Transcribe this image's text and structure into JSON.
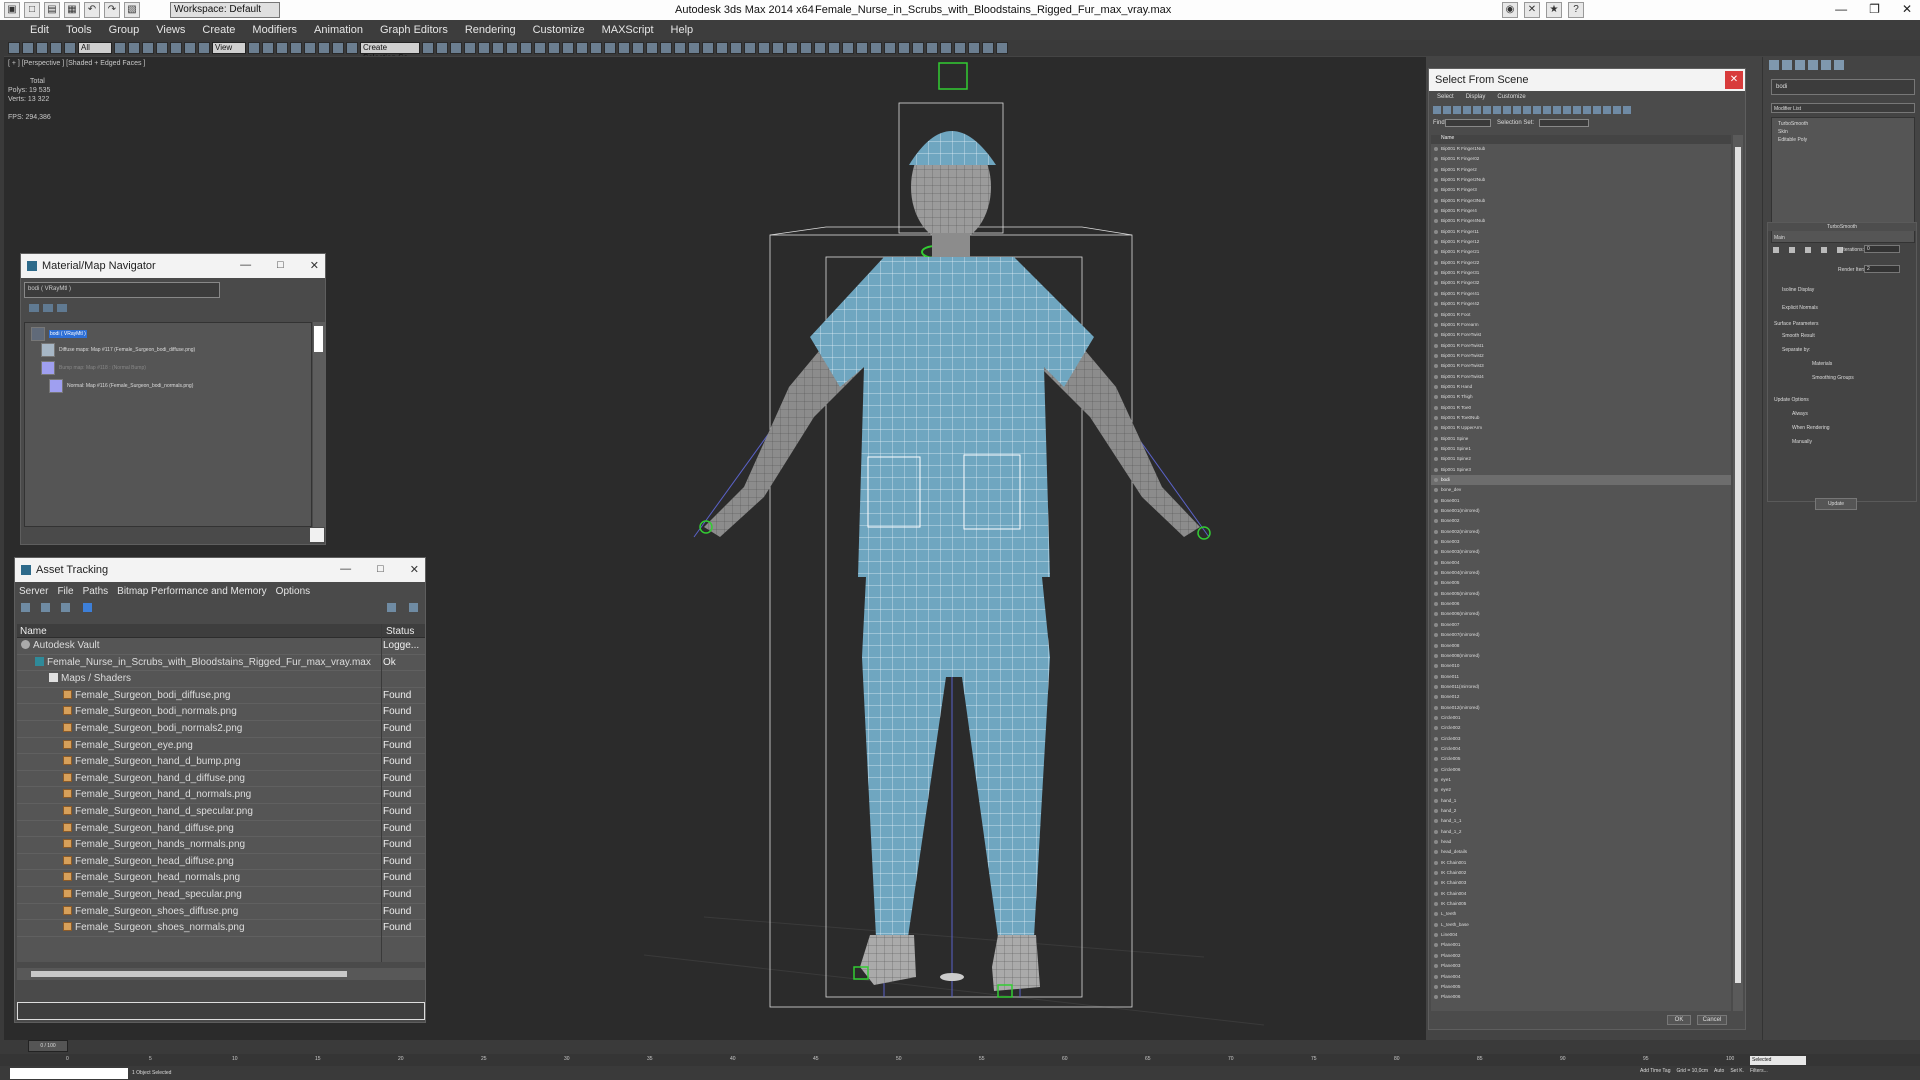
{
  "titlebar": {
    "workspace": "Workspace: Default",
    "app_title": "Autodesk 3ds Max  2014 x64",
    "file_title": "Female_Nurse_in_Scrubs_with_Bloodstains_Rigged_Fur_max_vray.max"
  },
  "menubar": [
    "Edit",
    "Tools",
    "Group",
    "Views",
    "Create",
    "Modifiers",
    "Animation",
    "Graph Editors",
    "Rendering",
    "Customize",
    "MAXScript",
    "Help"
  ],
  "toolbar": {
    "selection_filter": "All",
    "reference_coord": "View",
    "selection_set": "Create Selection Se"
  },
  "viewport": {
    "label": "[ + ] [Perspective ] [Shaded + Edged Faces ]",
    "stats": {
      "total_label": "Total",
      "polys_label": "Polys:",
      "polys_value": "19 535",
      "verts_label": "Verts:",
      "verts_value": "13 322",
      "fps_label": "FPS:",
      "fps_value": "294,386"
    }
  },
  "material_navigator": {
    "title": "Material/Map Navigator",
    "field": "bodi ( VRayMtl )",
    "tree": {
      "root": "bodi ( VRayMtl )",
      "diffuse": "Diffuse maps: Map #117 (Female_Surgeon_bodi_diffuse.png)",
      "bump": "Bump map: Map #118 : (Normal Bump)",
      "normal": "Normal: Map #116 (Female_Surgeon_bodi_normals.png)"
    }
  },
  "asset_tracking": {
    "title": "Asset Tracking",
    "menu": [
      "Server",
      "File",
      "Paths",
      "Bitmap Performance and Memory",
      "Options"
    ],
    "columns": {
      "name": "Name",
      "status": "Status"
    },
    "rows": [
      {
        "name": "Autodesk Vault",
        "status": "Logge...",
        "indent": 0,
        "icon": "vault"
      },
      {
        "name": "Female_Nurse_in_Scrubs_with_Bloodstains_Rigged_Fur_max_vray.max",
        "status": "Ok",
        "indent": 1,
        "icon": "max"
      },
      {
        "name": "Maps / Shaders",
        "status": "",
        "indent": 2,
        "icon": "folder"
      },
      {
        "name": "Female_Surgeon_bodi_diffuse.png",
        "status": "Found",
        "indent": 3,
        "icon": "file"
      },
      {
        "name": "Female_Surgeon_bodi_normals.png",
        "status": "Found",
        "indent": 3,
        "icon": "file"
      },
      {
        "name": "Female_Surgeon_bodi_normals2.png",
        "status": "Found",
        "indent": 3,
        "icon": "file"
      },
      {
        "name": "Female_Surgeon_eye.png",
        "status": "Found",
        "indent": 3,
        "icon": "file"
      },
      {
        "name": "Female_Surgeon_hand_d_bump.png",
        "status": "Found",
        "indent": 3,
        "icon": "file"
      },
      {
        "name": "Female_Surgeon_hand_d_diffuse.png",
        "status": "Found",
        "indent": 3,
        "icon": "file"
      },
      {
        "name": "Female_Surgeon_hand_d_normals.png",
        "status": "Found",
        "indent": 3,
        "icon": "file"
      },
      {
        "name": "Female_Surgeon_hand_d_specular.png",
        "status": "Found",
        "indent": 3,
        "icon": "file"
      },
      {
        "name": "Female_Surgeon_hand_diffuse.png",
        "status": "Found",
        "indent": 3,
        "icon": "file"
      },
      {
        "name": "Female_Surgeon_hands_normals.png",
        "status": "Found",
        "indent": 3,
        "icon": "file"
      },
      {
        "name": "Female_Surgeon_head_diffuse.png",
        "status": "Found",
        "indent": 3,
        "icon": "file"
      },
      {
        "name": "Female_Surgeon_head_normals.png",
        "status": "Found",
        "indent": 3,
        "icon": "file"
      },
      {
        "name": "Female_Surgeon_head_specular.png",
        "status": "Found",
        "indent": 3,
        "icon": "file"
      },
      {
        "name": "Female_Surgeon_shoes_diffuse.png",
        "status": "Found",
        "indent": 3,
        "icon": "file"
      },
      {
        "name": "Female_Surgeon_shoes_normals.png",
        "status": "Found",
        "indent": 3,
        "icon": "file"
      }
    ]
  },
  "select_from_scene": {
    "title": "Select From Scene",
    "menu": [
      "Select",
      "Display",
      "Customize"
    ],
    "find_label": "Find:",
    "selection_set_label": "Selection Set:",
    "column_name": "Name",
    "selected_item": "bodi",
    "items": [
      "Bip001 R Finger1Nub",
      "Bip001 R Finger02",
      "Bip001 R Finger2",
      "Bip001 R Finger2Nub",
      "Bip001 R Finger3",
      "Bip001 R Finger3Nub",
      "Bip001 R Finger4",
      "Bip001 R Finger4Nub",
      "Bip001 R Finger11",
      "Bip001 R Finger12",
      "Bip001 R Finger21",
      "Bip001 R Finger22",
      "Bip001 R Finger31",
      "Bip001 R Finger32",
      "Bip001 R Finger41",
      "Bip001 R Finger42",
      "Bip001 R Foot",
      "Bip001 R Forearm",
      "Bip001 R ForeTwist",
      "Bip001 R ForeTwist1",
      "Bip001 R ForeTwist2",
      "Bip001 R ForeTwist3",
      "Bip001 R ForeTwist4",
      "Bip001 R Hand",
      "Bip001 R Thigh",
      "Bip001 R Toe0",
      "Bip001 R Toe0Nub",
      "Bip001 R UpperArm",
      "Bip001 Spine",
      "Bip001 Spine1",
      "Bip001 Spine2",
      "Bip001 Spine3",
      "bodi",
      "bone_dev",
      "Bone001",
      "Bone001(mirrored)",
      "Bone002",
      "Bone002(mirrored)",
      "Bone003",
      "Bone003(mirrored)",
      "Bone004",
      "Bone004(mirrored)",
      "Bone005",
      "Bone005(mirrored)",
      "Bone006",
      "Bone006(mirrored)",
      "Bone007",
      "Bone007(mirrored)",
      "Bone008",
      "Bone008(mirrored)",
      "Bone010",
      "Bone011",
      "Bone011(mirrored)",
      "Bone012",
      "Bone012(mirrored)",
      "Circle001",
      "Circle002",
      "Circle003",
      "Circle004",
      "Circle005",
      "Circle006",
      "eye1",
      "eye2",
      "hand_1",
      "hand_2",
      "hand_1_1",
      "hand_1_2",
      "head",
      "head_details",
      "IK Chain001",
      "IK Chain002",
      "IK Chain003",
      "IK Chain004",
      "IK Chain005",
      "L_teeth",
      "L_teeth_base",
      "Line004",
      "Plane001",
      "Plane002",
      "Plane003",
      "Plane004",
      "Plane005",
      "Plane006"
    ],
    "ok_label": "OK",
    "cancel_label": "Cancel"
  },
  "command_panel": {
    "object_name": "bodi",
    "modifier_list_label": "Modifier List",
    "stack": [
      "TurboSmooth",
      "Skin",
      "Editable Poly"
    ],
    "turbosmooth_title": "TurboSmooth",
    "main_label": "Main",
    "iterations_label": "Iterations:",
    "iterations_value": "0",
    "render_iters_label": "Render Iters:",
    "render_iters_value": "2",
    "isoline_label": "Isoline Display",
    "explicit_normals_label": "Explicit Normals",
    "surface_params_label": "Surface Parameters",
    "smooth_result_label": "Smooth Result",
    "separate_by_label": "Separate by:",
    "materials_label": "Materials",
    "smoothing_groups_label": "Smoothing Groups",
    "update_options_label": "Update Options",
    "always_label": "Always",
    "when_rendering_label": "When Rendering",
    "manually_label": "Manually",
    "update_button": "Update"
  },
  "timeline": {
    "slider": "0 / 100",
    "ticks": [
      "0",
      "5",
      "10",
      "15",
      "20",
      "25",
      "30",
      "35",
      "40",
      "45",
      "50",
      "55",
      "60",
      "65",
      "70",
      "75",
      "80",
      "85",
      "90",
      "95",
      "100"
    ]
  },
  "statusbar": {
    "objects_text": "1 Object Selected",
    "grid_text": "Grid = 10,0cm",
    "add_time_tag": "Add Time Tag",
    "auto_label": "Auto",
    "set_key_label": "Set K.",
    "selected_dropdown": "Selected",
    "filters_label": "Filters..."
  }
}
